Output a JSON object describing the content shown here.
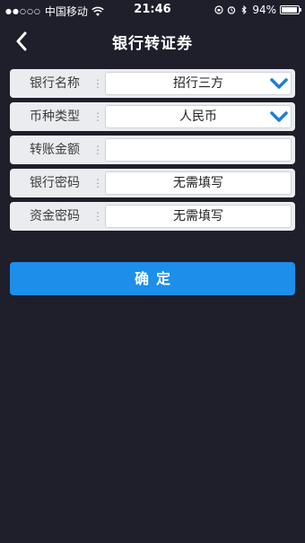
{
  "status_bar": {
    "signal": "●●○○○",
    "carrier": "中国移动",
    "time": "21:46",
    "battery_text": "94%",
    "battery_level": 0.94
  },
  "nav": {
    "title": "银行转证券",
    "back_icon": "chevron-left-icon"
  },
  "form": {
    "rows": [
      {
        "label": "银行名称",
        "value": "招行三方",
        "type": "select"
      },
      {
        "label": "币种类型",
        "value": "人民币",
        "type": "select"
      },
      {
        "label": "转账金额",
        "value": "",
        "type": "input"
      },
      {
        "label": "银行密码",
        "value": "无需填写",
        "type": "text"
      },
      {
        "label": "资金密码",
        "value": "无需填写",
        "type": "text"
      }
    ],
    "separator": "⋮"
  },
  "confirm_button": {
    "label": "确定"
  },
  "colors": {
    "background": "#1e1f2b",
    "accent": "#1d8eea",
    "row_bg": "#ebecf0"
  }
}
